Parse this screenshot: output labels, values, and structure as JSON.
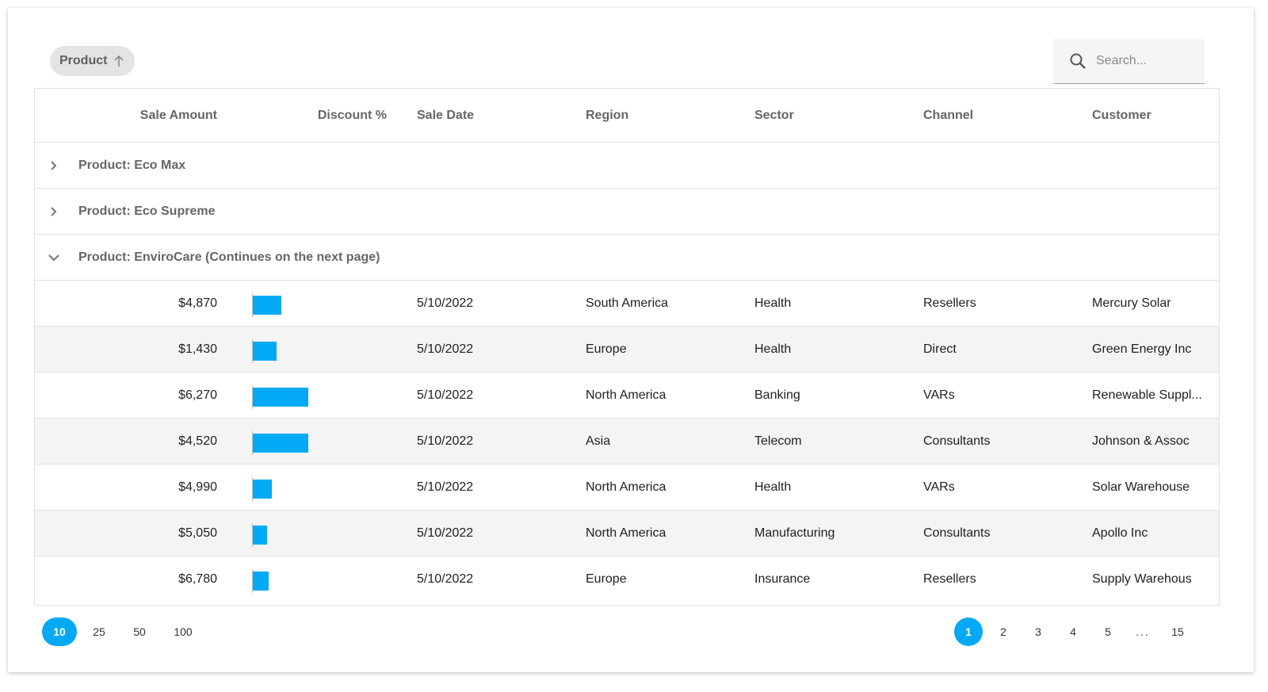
{
  "colors": {
    "accent": "#03a9f4",
    "alt_row": "#f4f4f4"
  },
  "toolbar": {
    "group_chip_label": "Product",
    "group_chip_icon": "arrow-up-icon",
    "search_icon": "search-icon",
    "search_placeholder": "Search..."
  },
  "columns": [
    "Sale Amount",
    "Discount %",
    "Sale Date",
    "Region",
    "Sector",
    "Channel",
    "Customer"
  ],
  "groups": [
    {
      "label": "Product: Eco Max",
      "expanded": false
    },
    {
      "label": "Product: Eco Supreme",
      "expanded": false
    },
    {
      "label": "Product: EnviroCare (Continues on the next page)",
      "expanded": true
    }
  ],
  "rows": [
    {
      "amount": "$4,870",
      "discount_pct": 0.52,
      "date": "5/10/2022",
      "region": "South America",
      "sector": "Health",
      "channel": "Resellers",
      "customer": "Mercury Solar"
    },
    {
      "amount": "$1,430",
      "discount_pct": 0.43,
      "date": "5/10/2022",
      "region": "Europe",
      "sector": "Health",
      "channel": "Direct",
      "customer": "Green Energy Inc"
    },
    {
      "amount": "$6,270",
      "discount_pct": 1.0,
      "date": "5/10/2022",
      "region": "North America",
      "sector": "Banking",
      "channel": "VARs",
      "customer": "Renewable Suppl..."
    },
    {
      "amount": "$4,520",
      "discount_pct": 1.0,
      "date": "5/10/2022",
      "region": "Asia",
      "sector": "Telecom",
      "channel": "Consultants",
      "customer": "Johnson & Assoc"
    },
    {
      "amount": "$4,990",
      "discount_pct": 0.34,
      "date": "5/10/2022",
      "region": "North America",
      "sector": "Health",
      "channel": "VARs",
      "customer": "Solar Warehouse"
    },
    {
      "amount": "$5,050",
      "discount_pct": 0.26,
      "date": "5/10/2022",
      "region": "North America",
      "sector": "Manufacturing",
      "channel": "Consultants",
      "customer": "Apollo Inc"
    },
    {
      "amount": "$6,780",
      "discount_pct": 0.29,
      "date": "5/10/2022",
      "region": "Europe",
      "sector": "Insurance",
      "channel": "Resellers",
      "customer": "Supply Warehous"
    }
  ],
  "pager": {
    "page_sizes": [
      "10",
      "25",
      "50",
      "100"
    ],
    "active_page_size": "10",
    "pages": [
      "1",
      "2",
      "3",
      "4",
      "5",
      "...",
      "15"
    ],
    "active_page": "1"
  }
}
